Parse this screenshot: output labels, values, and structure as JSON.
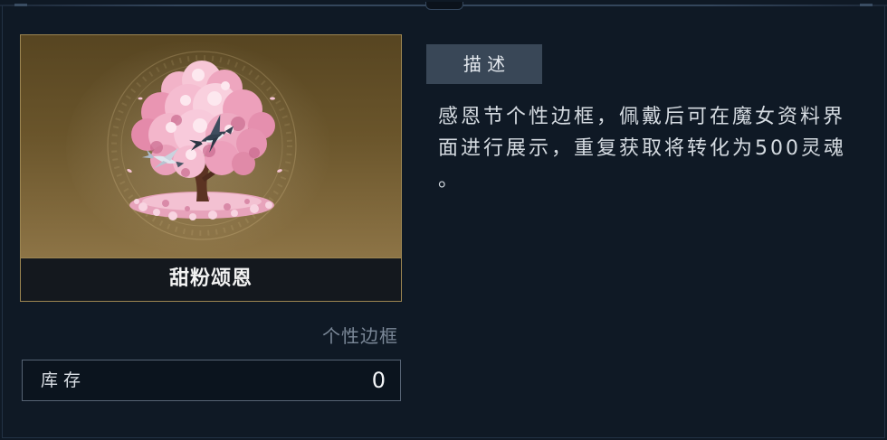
{
  "item": {
    "name": "甜粉颂恩",
    "type": "个性边框",
    "art_icon": "cherry-blossom-tree-icon"
  },
  "inventory": {
    "label": "库 存",
    "count": 0
  },
  "description": {
    "header": "描 述",
    "text": "感恩节个性边框，佩戴后可在魔女资料界面进行展示，重复获取将转化为500灵魂。"
  },
  "colors": {
    "background": "#0f1925",
    "card_border": "#9c8551",
    "header_tab": "#394757",
    "type_label": "#7b8898"
  }
}
